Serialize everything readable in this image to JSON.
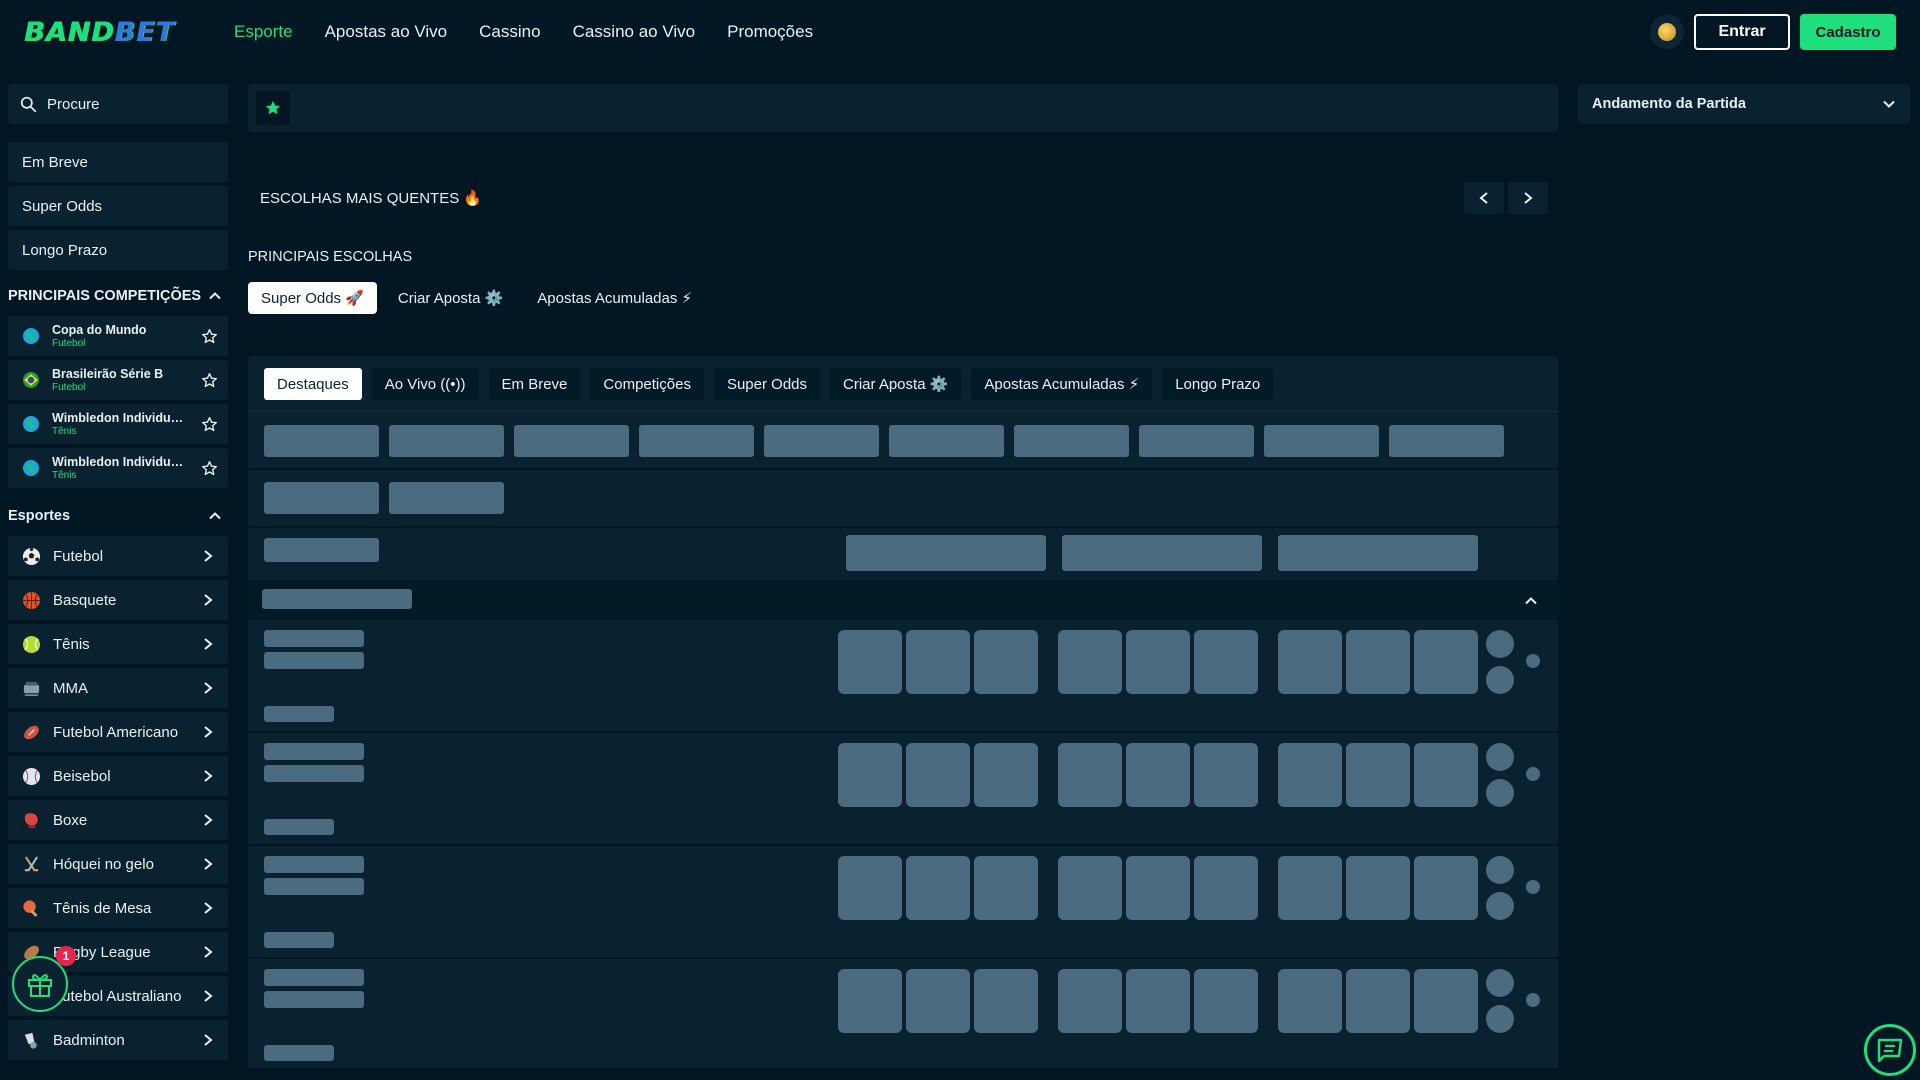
{
  "header": {
    "logo": {
      "part1": "BAND",
      "part2": "BET"
    },
    "nav": [
      {
        "label": "Esporte",
        "active": true
      },
      {
        "label": "Apostas ao Vivo",
        "active": false
      },
      {
        "label": "Cassino",
        "active": false
      },
      {
        "label": "Cassino ao Vivo",
        "active": false
      },
      {
        "label": "Promoções",
        "active": false
      }
    ],
    "login_label": "Entrar",
    "signup_label": "Cadastro"
  },
  "sidebar": {
    "search_placeholder": "Procure",
    "quick_items": [
      "Em Breve",
      "Super Odds",
      "Longo Prazo"
    ],
    "competitions_title": "PRINCIPAIS COMPETIÇÕES",
    "competitions": [
      {
        "name": "Copa do Mundo",
        "sport": "Futebol",
        "icon": "globe-icon"
      },
      {
        "name": "Brasileirão Série B",
        "sport": "Futebol",
        "icon": "brazil-flag-icon"
      },
      {
        "name": "Wimbledon Individuais Masculino",
        "sport": "Tênis",
        "icon": "globe-icon"
      },
      {
        "name": "Wimbledon Individuais Feminino",
        "sport": "Tênis",
        "icon": "globe-icon"
      }
    ],
    "sports_title": "Esportes",
    "sports": [
      {
        "label": "Futebol",
        "icon": "soccer-ball-icon",
        "color": "#e8e8e8"
      },
      {
        "label": "Basquete",
        "icon": "basketball-icon",
        "color": "#d9532c"
      },
      {
        "label": "Tênis",
        "icon": "tennis-ball-icon",
        "color": "#b6d93a"
      },
      {
        "label": "MMA",
        "icon": "mma-icon",
        "color": "#8aa0b0"
      },
      {
        "label": "Futebol Americano",
        "icon": "american-football-icon",
        "color": "#c8564a"
      },
      {
        "label": "Beisebol",
        "icon": "baseball-icon",
        "color": "#dfe6ee"
      },
      {
        "label": "Boxe",
        "icon": "boxing-glove-icon",
        "color": "#d84545"
      },
      {
        "label": "Hóquei no gelo",
        "icon": "hockey-sticks-icon",
        "color": "#c9a56a"
      },
      {
        "label": "Tênis de Mesa",
        "icon": "table-tennis-icon",
        "color": "#e66a3c"
      },
      {
        "label": "Rugby League",
        "icon": "rugby-ball-icon",
        "color": "#b87a4a"
      },
      {
        "label": "Futebol Australiano",
        "icon": "aussie-football-icon",
        "color": "#c8a040"
      },
      {
        "label": "Badminton",
        "icon": "shuttlecock-icon",
        "color": "#d8dde4"
      }
    ]
  },
  "main": {
    "hot_title": "ESCOLHAS MAIS QUENTES 🔥",
    "top_picks_title": "PRINCIPAIS ESCOLHAS",
    "pick_tabs": [
      {
        "label": "Super Odds 🚀",
        "active": true
      },
      {
        "label": "Criar Aposta ⚙️",
        "active": false
      },
      {
        "label": "Apostas Acumuladas ⚡",
        "active": false
      }
    ],
    "panel_tabs": [
      {
        "label": "Destaques",
        "active": true
      },
      {
        "label": "Ao Vivo ((•))",
        "active": false
      },
      {
        "label": "Em Breve",
        "active": false
      },
      {
        "label": "Competições",
        "active": false
      },
      {
        "label": "Super Odds",
        "active": false
      },
      {
        "label": "Criar Aposta ⚙️",
        "active": false
      },
      {
        "label": "Apostas Acumuladas ⚡",
        "active": false
      },
      {
        "label": "Longo Prazo",
        "active": false
      }
    ]
  },
  "right_panel": {
    "title": "Andamento da Partida"
  },
  "floating": {
    "gift_badge_count": "1"
  },
  "colors": {
    "background": "#001622",
    "panel": "#0a2230",
    "accent": "#1fdf7c",
    "skeleton": "#4b6b80"
  }
}
